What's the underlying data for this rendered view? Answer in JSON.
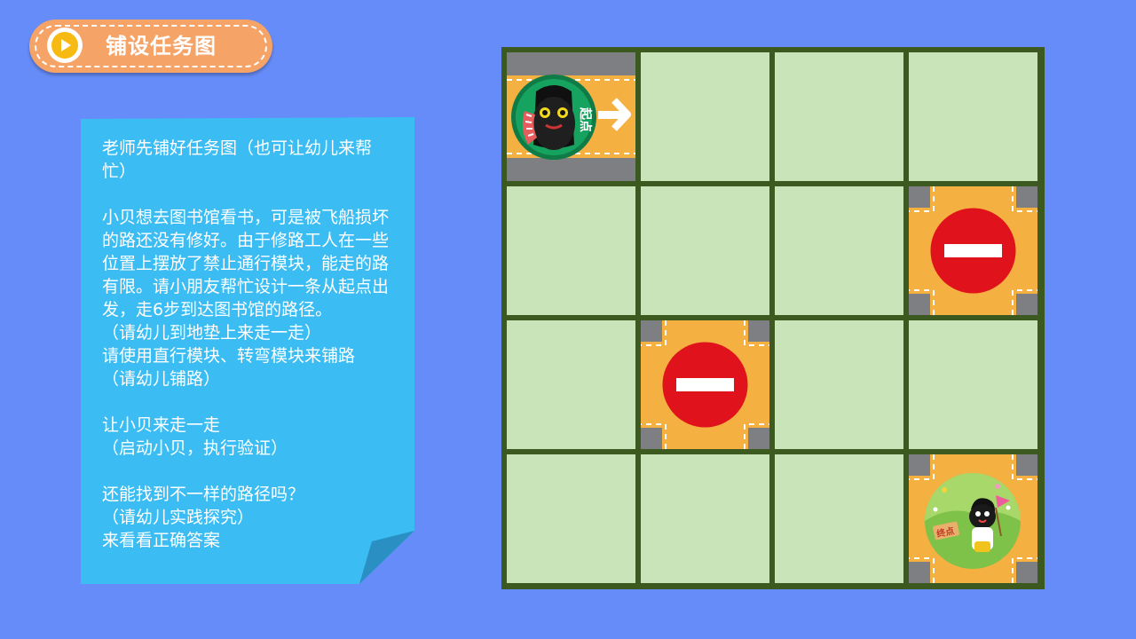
{
  "title": "铺设任务图",
  "note": {
    "text": "老师先铺好任务图（也可让幼儿来帮忙）\n\n小贝想去图书馆看书，可是被飞船损坏的路还没有修好。由于修路工人在一些位置上摆放了禁止通行模块，能走的路有限。请小朋友帮忙设计一条从起点出发，走6步到达图书馆的路径。\n（请幼儿到地垫上来走一走）\n请使用直行模块、转弯模块来铺路\n（请幼儿铺路）\n\n让小贝来走一走\n（启动小贝，执行验证）\n\n还能找到不一样的路径吗？\n（请幼儿实践探究）\n来看看正确答案"
  },
  "board": {
    "start_label": "起点",
    "end_label": "终点"
  },
  "colors": {
    "background": "#668cf9",
    "grass": "#c9e4b9",
    "grid": "#3c5a20",
    "tile_orange": "#f5b042",
    "stop_red": "#e0121b",
    "note_blue": "#3bbdf3"
  }
}
